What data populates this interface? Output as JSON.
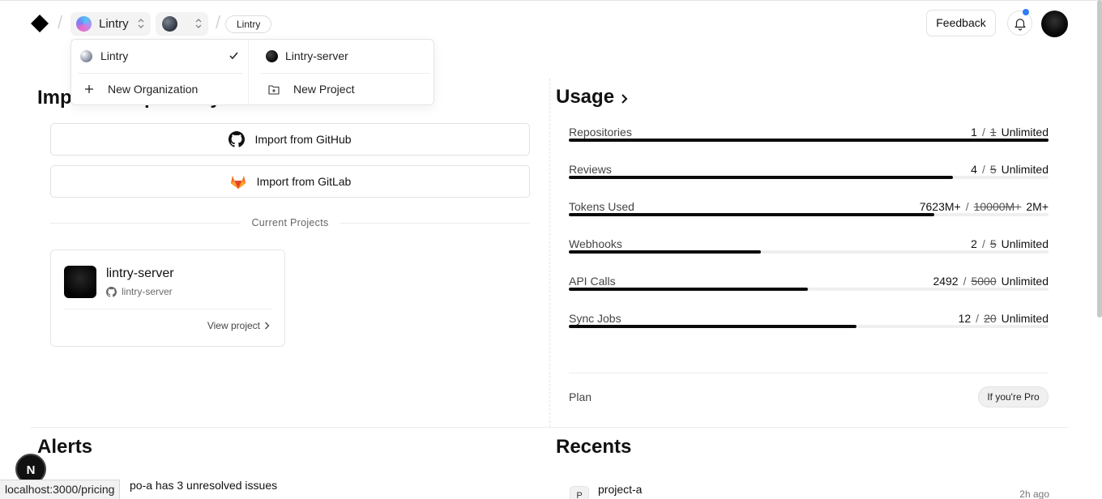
{
  "header": {
    "org_name": "Lintry",
    "crumb": "Lintry",
    "feedback_label": "Feedback"
  },
  "dropdown": {
    "org_item": "Lintry",
    "new_org_label": "New Organization",
    "project_item": "Lintry-server",
    "new_project_label": "New Project"
  },
  "import": {
    "heading": "Import a Repository",
    "github_label": "Import from GitHub",
    "gitlab_label": "Import from GitLab",
    "current_projects_label": "Current Projects"
  },
  "project_card": {
    "name": "lintry-server",
    "repo": "lintry-server",
    "view_label": "View project"
  },
  "usage": {
    "title": "Usage",
    "rows": [
      {
        "label": "Repositories",
        "current": "1",
        "old_limit": "1",
        "new_limit": "Unlimited",
        "fill": 1.0
      },
      {
        "label": "Reviews",
        "current": "4",
        "old_limit": "5",
        "new_limit": "Unlimited",
        "fill": 0.8
      },
      {
        "label": "Tokens Used",
        "current": "7623M+",
        "old_limit": "10000M+",
        "new_limit": "2M+",
        "fill": 0.762
      },
      {
        "label": "Webhooks",
        "current": "2",
        "old_limit": "5",
        "new_limit": "Unlimited",
        "fill": 0.4
      },
      {
        "label": "API Calls",
        "current": "2492",
        "old_limit": "5000",
        "new_limit": "Unlimited",
        "fill": 0.498
      },
      {
        "label": "Sync Jobs",
        "current": "12",
        "old_limit": "20",
        "new_limit": "Unlimited",
        "fill": 0.6
      }
    ],
    "plan_label": "Plan",
    "plan_value": "If you're Pro"
  },
  "alerts": {
    "title": "Alerts",
    "item_text": "po-a has 3 unresolved issues"
  },
  "recents": {
    "title": "Recents",
    "item_badge": "P",
    "item_name": "project-a",
    "item_time": "2h ago"
  },
  "overlay": {
    "next_badge": "N",
    "status_url": "localhost:3000/pricing"
  }
}
